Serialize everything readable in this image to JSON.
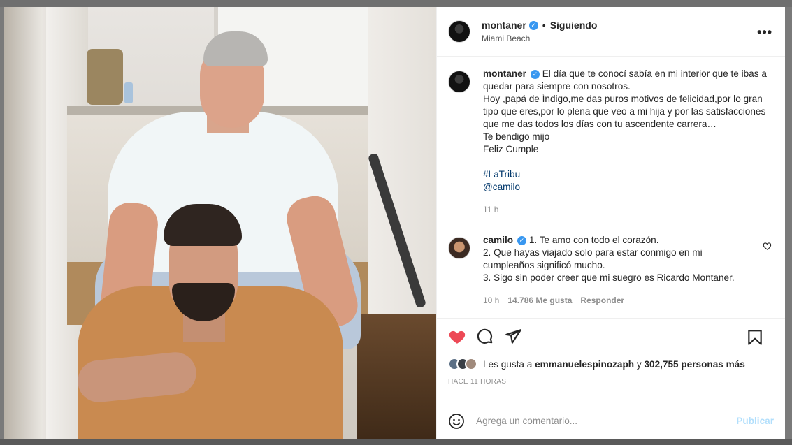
{
  "post": {
    "author": "montaner",
    "follow_status": "Siguiendo",
    "location": "Miami Beach",
    "more_label": "•••"
  },
  "caption": {
    "username": "montaner",
    "text": "El día que te conocí sabía en mi interior que te ibas a quedar para siempre con nosotros.\nHoy ,papá de Índigo,me das puros motivos de felicidad,por lo gran tipo que eres,por lo plena que veo a mi hija y por las satisfacciones que me das todos los días con tu ascendente carrera…\nTe bendigo mijo\nFeliz Cumple",
    "hashtag": "#LaTribu",
    "mention": "@camilo",
    "time": "11 h"
  },
  "comment": {
    "username": "camilo",
    "text": "1. Te amo con todo el corazón.\n2. Que hayas viajado solo para estar conmigo en mi cumpleaños significó mucho.\n3. Sigo sin poder creer que mi suegro es Ricardo Montaner.",
    "time": "10 h",
    "likes": "14.786 Me gusta",
    "reply": "Responder"
  },
  "likes": {
    "prefix": "Les gusta a",
    "user": "emmanuelespinozaph",
    "connector": "y",
    "count": "302,755 personas más"
  },
  "posted_ago": "HACE 11 HORAS",
  "add_comment": {
    "placeholder": "Agrega un comentario...",
    "publish": "Publicar"
  },
  "colors": {
    "verified": "#3897f0",
    "like_red": "#ed4956",
    "link": "#00376b",
    "publish_disabled": "#b2dffc"
  },
  "icons": [
    "verified-badge-icon",
    "more-icon",
    "heart-icon",
    "comment-icon",
    "share-icon",
    "bookmark-icon",
    "emoji-icon"
  ]
}
